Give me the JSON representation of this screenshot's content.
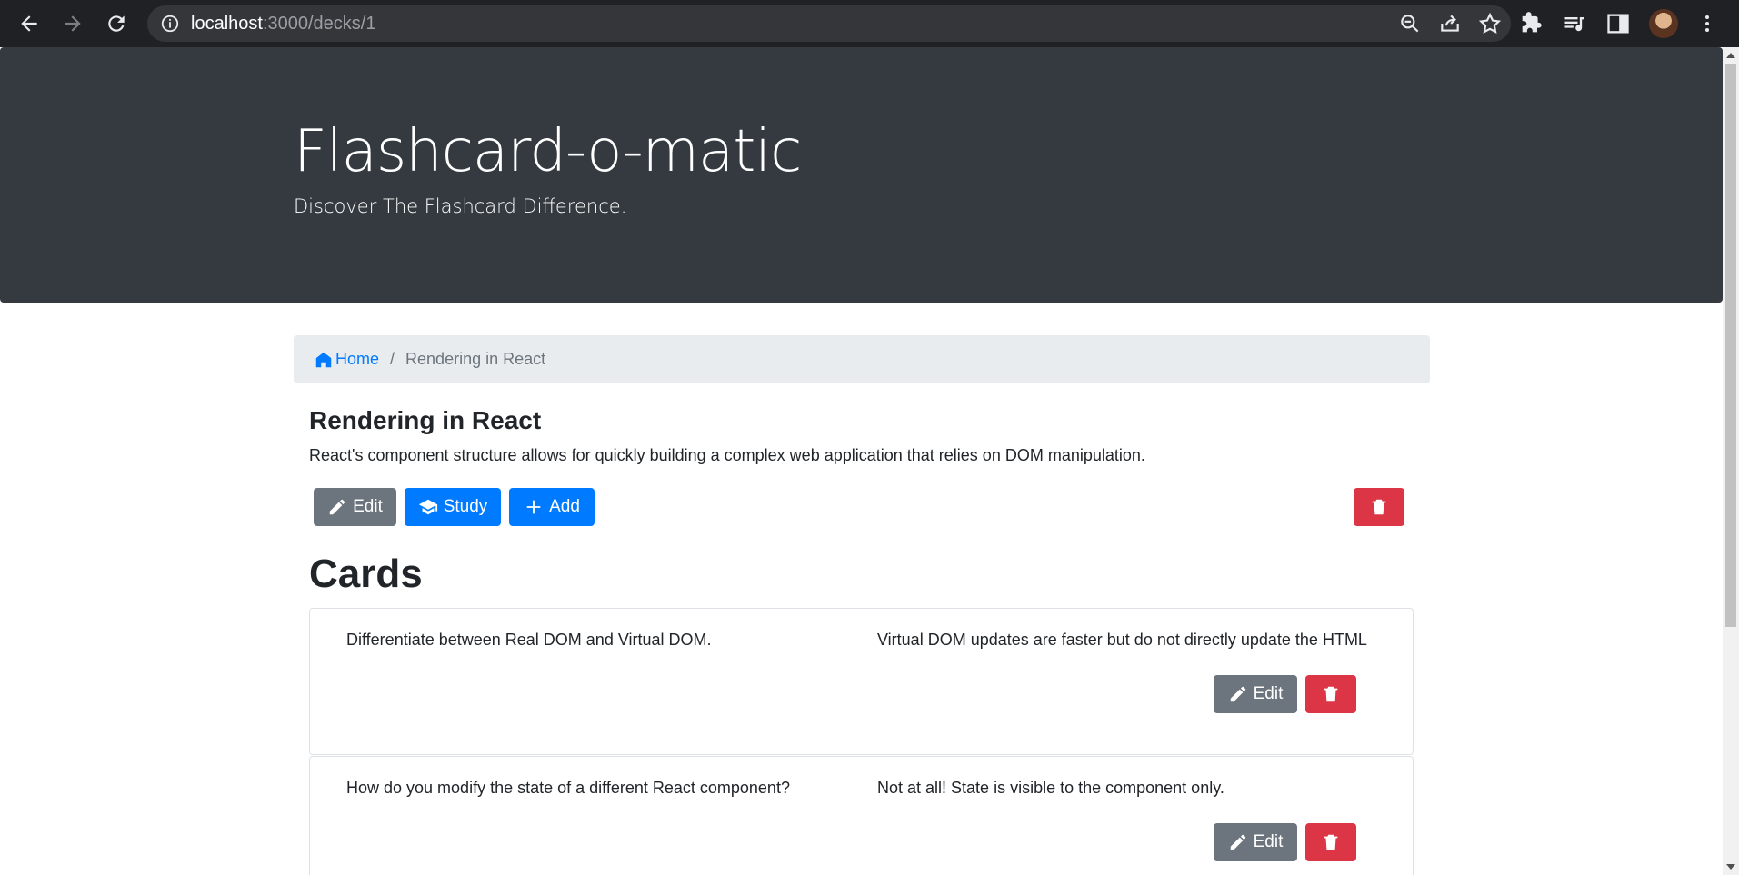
{
  "browser": {
    "url_host": "localhost",
    "url_path": ":3000/decks/1"
  },
  "header": {
    "title": "Flashcard-o-matic",
    "subtitle": "Discover The Flashcard Difference."
  },
  "breadcrumb": {
    "home_label": "Home",
    "separator": "/",
    "current": "Rendering in React"
  },
  "deck": {
    "name": "Rendering in React",
    "description": "React's component structure allows for quickly building a complex web application that relies on DOM manipulation.",
    "edit_label": "Edit",
    "study_label": "Study",
    "add_label": "Add"
  },
  "cards_section": {
    "title": "Cards",
    "cards": [
      {
        "front": "Differentiate between Real DOM and Virtual DOM.",
        "back": "Virtual DOM updates are faster but do not directly update the HTML",
        "edit_label": "Edit"
      },
      {
        "front": "How do you modify the state of a different React component?",
        "back": "Not at all! State is visible to the component only.",
        "edit_label": "Edit"
      }
    ]
  },
  "colors": {
    "jumbotron": "#343a40",
    "primary": "#007bff",
    "secondary": "#6c757d",
    "danger": "#dc3545",
    "breadcrumb_bg": "#e9ecef"
  },
  "icons": {
    "home": "home-icon",
    "edit": "pencil-icon",
    "study": "graduation-cap-icon",
    "add": "plus-icon",
    "delete": "trash-icon"
  }
}
